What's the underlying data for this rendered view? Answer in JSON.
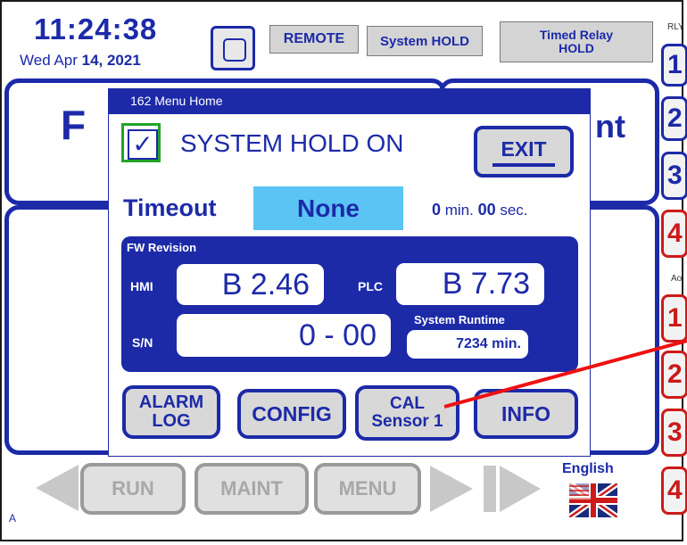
{
  "header": {
    "time": "11:24:38",
    "date_prefix": "Wed  Apr ",
    "date_bold": "14, 2021",
    "remote_label": "REMOTE",
    "system_hold_label": "System HOLD",
    "timed_relay_line1": "Timed Relay",
    "timed_relay_line2": "HOLD"
  },
  "background": {
    "panel_left_partial": "F",
    "panel_right_partial": "nt"
  },
  "right_rail": {
    "rly_label": "RLY",
    "ao_label": "Ao",
    "relay_buttons": [
      "1",
      "2",
      "3",
      "4"
    ],
    "ao_buttons": [
      "1",
      "2",
      "3",
      "4"
    ]
  },
  "dialog": {
    "title": "162  Menu Home",
    "checkbox_mark": "✓",
    "hold_text": "SYSTEM HOLD ON",
    "exit_label": "EXIT",
    "timeout_label": "Timeout",
    "timeout_value": "None",
    "timeout_min_value": "0",
    "timeout_min_unit": " min. ",
    "timeout_sec_value": "00",
    "timeout_sec_unit": " sec.",
    "fw_revision_label": "FW Revision",
    "hmi_label": "HMI",
    "hmi_value": "B  2.46",
    "plc_label": "PLC",
    "plc_value": "B  7.73",
    "sn_label": "S/N",
    "sn_value": "0 - 00",
    "runtime_label": "System Runtime",
    "runtime_value": "7234 min.",
    "alarm_log_line1": "ALARM",
    "alarm_log_line2": "LOG",
    "config_label": "CONFIG",
    "cal_line1": "CAL",
    "cal_line2": "Sensor 1",
    "info_label": "INFO"
  },
  "footer": {
    "run_label": "RUN",
    "maint_label": "MAINT",
    "menu_label": "MENU",
    "language_label": "English",
    "corner_label": "A"
  },
  "colors": {
    "accent": "#1c2aa8",
    "highlight": "#5bc4f5",
    "alert": "#cc1a1a",
    "pointer_line": "#ee1111"
  }
}
